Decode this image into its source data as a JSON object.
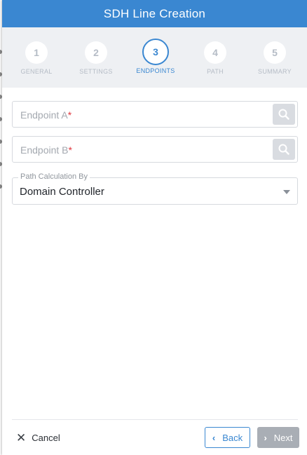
{
  "dialog": {
    "title": "SDH Line Creation"
  },
  "stepper": {
    "steps": [
      {
        "number": "1",
        "label": "GENERAL",
        "active": false
      },
      {
        "number": "2",
        "label": "SETTINGS",
        "active": false
      },
      {
        "number": "3",
        "label": "ENDPOINTS",
        "active": true
      },
      {
        "number": "4",
        "label": "PATH",
        "active": false
      },
      {
        "number": "5",
        "label": "SUMMARY",
        "active": false
      }
    ]
  },
  "form": {
    "endpoint_a": {
      "placeholder": "Endpoint A",
      "required_mark": "*",
      "value": ""
    },
    "endpoint_b": {
      "placeholder": "Endpoint B",
      "required_mark": "*",
      "value": ""
    },
    "path_calculation": {
      "label": "Path Calculation By",
      "value": "Domain Controller"
    }
  },
  "footer": {
    "cancel_label": "Cancel",
    "back_label": "Back",
    "next_label": "Next"
  },
  "colors": {
    "accent": "#3a87d1",
    "required": "#e0363d",
    "disabled_button": "#a9aeb5"
  },
  "icons": {
    "search": "search-icon",
    "caret": "chevron-down-icon",
    "cancel": "close-icon",
    "back": "chevron-left-icon",
    "next": "chevron-right-icon"
  }
}
